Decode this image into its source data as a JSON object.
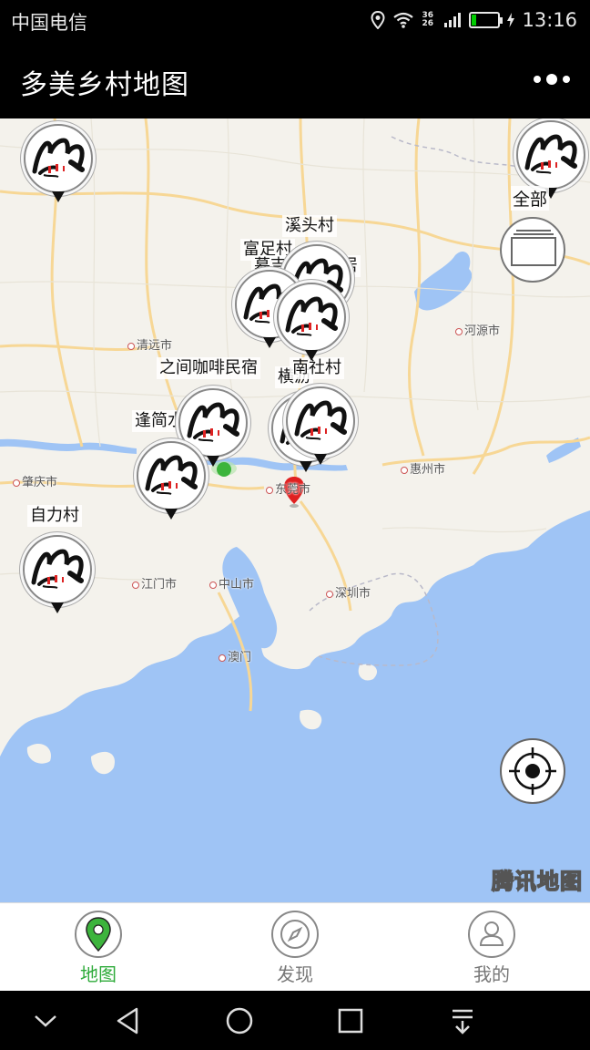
{
  "status_bar": {
    "carrier": "中国电信",
    "network": "36 26",
    "battery": "16",
    "battery_level": 0.16,
    "time": "13:16",
    "icons": [
      "location-icon",
      "wifi-icon",
      "signal-icon",
      "battery-icon",
      "charging-icon"
    ]
  },
  "header": {
    "title": "多美乡村地图",
    "menu_icon": "more-dots-icon"
  },
  "map": {
    "provider": "腾讯地图",
    "colors": {
      "land": "#f4f2ec",
      "water": "#9fc4f5",
      "road": "#f7d795",
      "marker_red": "#e02020",
      "marker_green": "#3db43d"
    },
    "cities": [
      "清远市",
      "河源市",
      "肇庆市",
      "惠州市",
      "东莞市",
      "江门市",
      "中山市",
      "深圳市",
      "澳门"
    ],
    "poi_labels": [
      "溪头村",
      "富足村",
      "慕吉.云溪山居",
      "之间咖啡民宿",
      "横沥",
      "南社村",
      "逢简水乡",
      "自力村"
    ],
    "controls": {
      "all_label": "全部"
    }
  },
  "tabs": [
    {
      "label": "地图",
      "icon": "map-pin-icon",
      "active": true
    },
    {
      "label": "发现",
      "icon": "compass-icon",
      "active": false
    },
    {
      "label": "我的",
      "icon": "user-icon",
      "active": false
    }
  ],
  "nav_bar": {
    "icons": [
      "collapse-icon",
      "back-icon",
      "home-icon",
      "recents-icon",
      "notification-pull-icon"
    ]
  }
}
